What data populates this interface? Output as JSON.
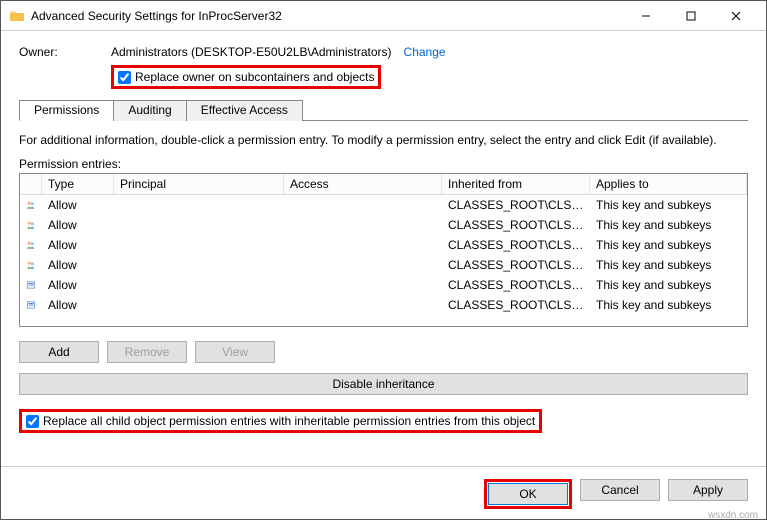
{
  "titlebar": {
    "title": "Advanced Security Settings for InProcServer32"
  },
  "owner": {
    "label": "Owner:",
    "value": "Administrators (DESKTOP-E50U2LB\\Administrators)",
    "change": "Change",
    "replace_label": "Replace owner on subcontainers and objects"
  },
  "tabs": {
    "permissions": "Permissions",
    "auditing": "Auditing",
    "effective": "Effective Access"
  },
  "info_text": "For additional information, double-click a permission entry. To modify a permission entry, select the entry and click Edit (if available).",
  "pe_label": "Permission entries:",
  "headers": {
    "type": "Type",
    "principal": "Principal",
    "access": "Access",
    "inherited": "Inherited from",
    "applies": "Applies to"
  },
  "rows": [
    {
      "icon": "group",
      "type": "Allow",
      "principal": "",
      "access": "",
      "inherited": "CLASSES_ROOT\\CLSID...",
      "applies": "This key and subkeys"
    },
    {
      "icon": "group",
      "type": "Allow",
      "principal": "",
      "access": "",
      "inherited": "CLASSES_ROOT\\CLSID...",
      "applies": "This key and subkeys"
    },
    {
      "icon": "group",
      "type": "Allow",
      "principal": "",
      "access": "",
      "inherited": "CLASSES_ROOT\\CLSID...",
      "applies": "This key and subkeys"
    },
    {
      "icon": "group",
      "type": "Allow",
      "principal": "",
      "access": "",
      "inherited": "CLASSES_ROOT\\CLSID...",
      "applies": "This key and subkeys"
    },
    {
      "icon": "sys",
      "type": "Allow",
      "principal": "",
      "access": "",
      "inherited": "CLASSES_ROOT\\CLSID...",
      "applies": "This key and subkeys"
    },
    {
      "icon": "sys",
      "type": "Allow",
      "principal": "",
      "access": "",
      "inherited": "CLASSES_ROOT\\CLSID...",
      "applies": "This key and subkeys"
    }
  ],
  "buttons": {
    "add": "Add",
    "remove": "Remove",
    "view": "View",
    "disable": "Disable inheritance"
  },
  "child_label": "Replace all child object permission entries with inheritable permission entries from this object",
  "footer": {
    "ok": "OK",
    "cancel": "Cancel",
    "apply": "Apply"
  },
  "watermark": "wsxdn.com"
}
